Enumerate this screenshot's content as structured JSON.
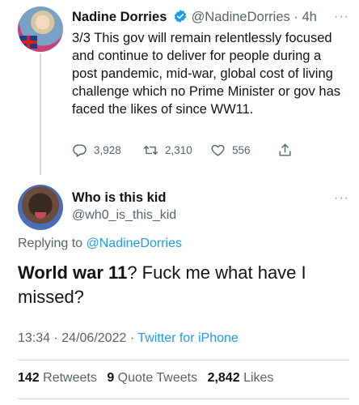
{
  "original_tweet": {
    "author_name": "Nadine Dorries",
    "author_handle": "@NadineDorries",
    "separator": "·",
    "time_ago": "4h",
    "more_label": "···",
    "text": "3/3 This gov will remain relentlessly focused and continue to deliver for people during a post pandemic, mid-war, global cost of living challenge which no Prime Minister or gov has faced the likes of since WW11.",
    "replies": "3,928",
    "retweets": "2,310",
    "likes": "556",
    "icons": {
      "reply": "reply-icon",
      "retweet": "retweet-icon",
      "like": "heart-icon",
      "share": "share-icon",
      "verified": "verified-badge-icon"
    },
    "verified_color": "#1d9bf0"
  },
  "reply_tweet": {
    "author_name": "Who is this kid",
    "author_handle": "@wh0_is_this_kid",
    "more_label": "···",
    "replying_prefix": "Replying to",
    "replying_mention": "@NadineDorries",
    "text_bold": "World war 11",
    "text_rest": "? Fuck me what have I missed?",
    "time": "13:34",
    "dot": "·",
    "date": "24/06/2022",
    "source": "Twitter for iPhone",
    "retweet_count": "142",
    "retweet_label": "Retweets",
    "quote_count": "9",
    "quote_label": "Quote Tweets",
    "like_count": "2,842",
    "like_label": "Likes"
  },
  "colors": {
    "link": "#1d9bf0",
    "secondary_text": "#536471",
    "primary_text": "#0f1419",
    "divider": "#cfd9de"
  }
}
